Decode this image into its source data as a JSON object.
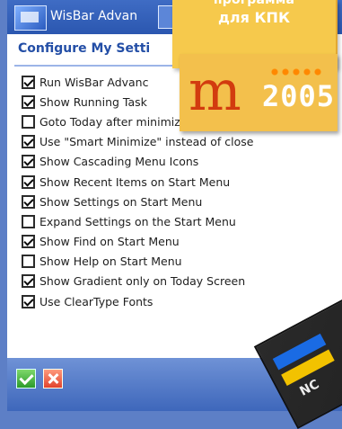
{
  "window": {
    "title": "WisBar Advan",
    "header": "Configure My Setti"
  },
  "options": [
    {
      "label": "Run WisBar Advanc",
      "checked": true
    },
    {
      "label": "Show Running Task",
      "checked": true
    },
    {
      "label": "Goto Today after minimize",
      "checked": false
    },
    {
      "label": "Use \"Smart Minimize\" instead of close",
      "checked": true
    },
    {
      "label": "Show Cascading Menu Icons",
      "checked": true
    },
    {
      "label": "Show Recent Items on Start Menu",
      "checked": true
    },
    {
      "label": "Show Settings on Start Menu",
      "checked": true
    },
    {
      "label": "Expand Settings on the Start Menu",
      "checked": false
    },
    {
      "label": "Show Find on Start Menu",
      "checked": true
    },
    {
      "label": "Show Help on Start Menu",
      "checked": false
    },
    {
      "label": "Show Gradient only on Today Screen",
      "checked": true
    },
    {
      "label": "Use ClearType Fonts",
      "checked": true
    }
  ],
  "buttons": {
    "ok": "✓",
    "cancel": "✕"
  },
  "sticker": {
    "line1": "программа",
    "line2": "для КПК"
  },
  "badge": {
    "logo": "m",
    "year": "2005"
  },
  "boxart": {
    "label": "NC"
  }
}
